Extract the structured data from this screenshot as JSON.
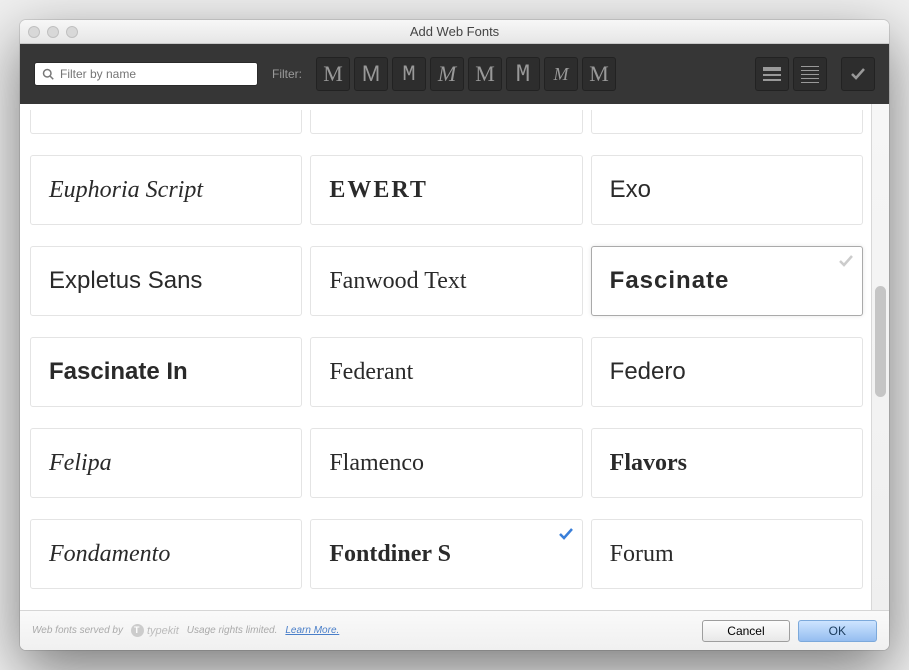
{
  "window": {
    "title": "Add Web Fonts"
  },
  "toolbar": {
    "search_placeholder": "Filter by name",
    "filter_label": "Filter:",
    "style_filters": [
      "M",
      "M",
      "M",
      "M",
      "M",
      "M",
      "M",
      "M"
    ]
  },
  "fonts": [
    {
      "name": "Euphoria Script",
      "css": "f-euphoria",
      "selected": false
    },
    {
      "name": "EWERT",
      "css": "f-ewert",
      "selected": false
    },
    {
      "name": "Exo",
      "css": "f-exo",
      "selected": false
    },
    {
      "name": "Expletus Sans",
      "css": "f-expletus",
      "selected": false
    },
    {
      "name": "Fanwood Text",
      "css": "f-fanwood",
      "selected": false
    },
    {
      "name": "Fascinate",
      "css": "f-fascinate",
      "selected": true,
      "checkmark": "gray"
    },
    {
      "name": "Fascinate In",
      "css": "f-fascinate-in",
      "selected": false
    },
    {
      "name": "Federant",
      "css": "f-federant",
      "selected": false
    },
    {
      "name": "Federo",
      "css": "f-federo",
      "selected": false
    },
    {
      "name": "Felipa",
      "css": "f-felipa",
      "selected": false
    },
    {
      "name": "Flamenco",
      "css": "f-flamenco",
      "selected": false
    },
    {
      "name": "Flavors",
      "css": "f-flavors",
      "selected": false
    },
    {
      "name": "Fondamento",
      "css": "f-fondamento",
      "selected": false
    },
    {
      "name": "Fontdiner S",
      "css": "f-fontdiner",
      "selected": false,
      "checkmark": "blue"
    },
    {
      "name": "Forum",
      "css": "f-forum",
      "selected": false
    }
  ],
  "footer": {
    "served_by": "Web fonts served by",
    "brand": "typekit",
    "rights": "Usage rights limited.",
    "learn_more": "Learn More.",
    "cancel": "Cancel",
    "ok": "OK"
  }
}
